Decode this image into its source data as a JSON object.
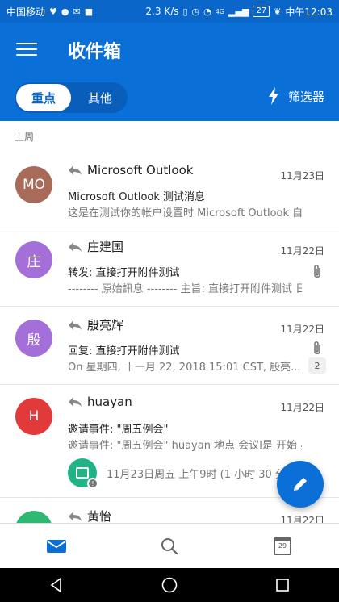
{
  "status_bar": {
    "carrier": "中国移动",
    "net_speed": "2.3 K/s",
    "signal_label": "4G",
    "battery": "27",
    "time": "中午12:03"
  },
  "header": {
    "title": "收件箱",
    "tabs": [
      {
        "label": "重点",
        "active": true
      },
      {
        "label": "其他",
        "active": false
      }
    ],
    "filter_label": "筛选器"
  },
  "section_label": "上周",
  "mails": [
    {
      "initials": "MO",
      "avatar_color": "#a86b5a",
      "sender": "Microsoft Outlook",
      "date": "11月23日",
      "subject": "Microsoft Outlook 测试消息",
      "preview": "这是在测试你的帐户设置时 Microsoft Outlook 自..."
    },
    {
      "initials": "庄",
      "avatar_color": "#a46fd8",
      "sender": "庄建国",
      "date": "11月22日",
      "subject": "转发: 直接打开附件测试",
      "preview": "-------- 原始訊息 -------- 主旨: 直接打开附件测试 日期..."
    },
    {
      "initials": "殷",
      "avatar_color": "#a46fd8",
      "sender": "殷亮辉",
      "date": "11月22日",
      "subject": "回复: 直接打开附件测试",
      "preview": "On 星期四, 十一月 22, 2018 15:01 CST, 殷亮...",
      "attachment_count": "2"
    },
    {
      "initials": "H",
      "avatar_color": "#e23a3a",
      "sender": "huayan",
      "date": "11月22日",
      "subject": "邀请事件: \"周五例会\"",
      "preview": "邀请事件: \"周五例会\" huayan 地点 会议l是 开始 星...",
      "event_text": "11月23日周五 上午9时 (1 小时 30 分"
    },
    {
      "initials": "",
      "avatar_color": "#2eb872",
      "sender": "黄怡",
      "date": "11月22日"
    }
  ],
  "bottom_nav": {
    "calendar_day": "29"
  },
  "colors": {
    "brand": "#0a6fd6",
    "status_bar": "#0a66c8"
  }
}
